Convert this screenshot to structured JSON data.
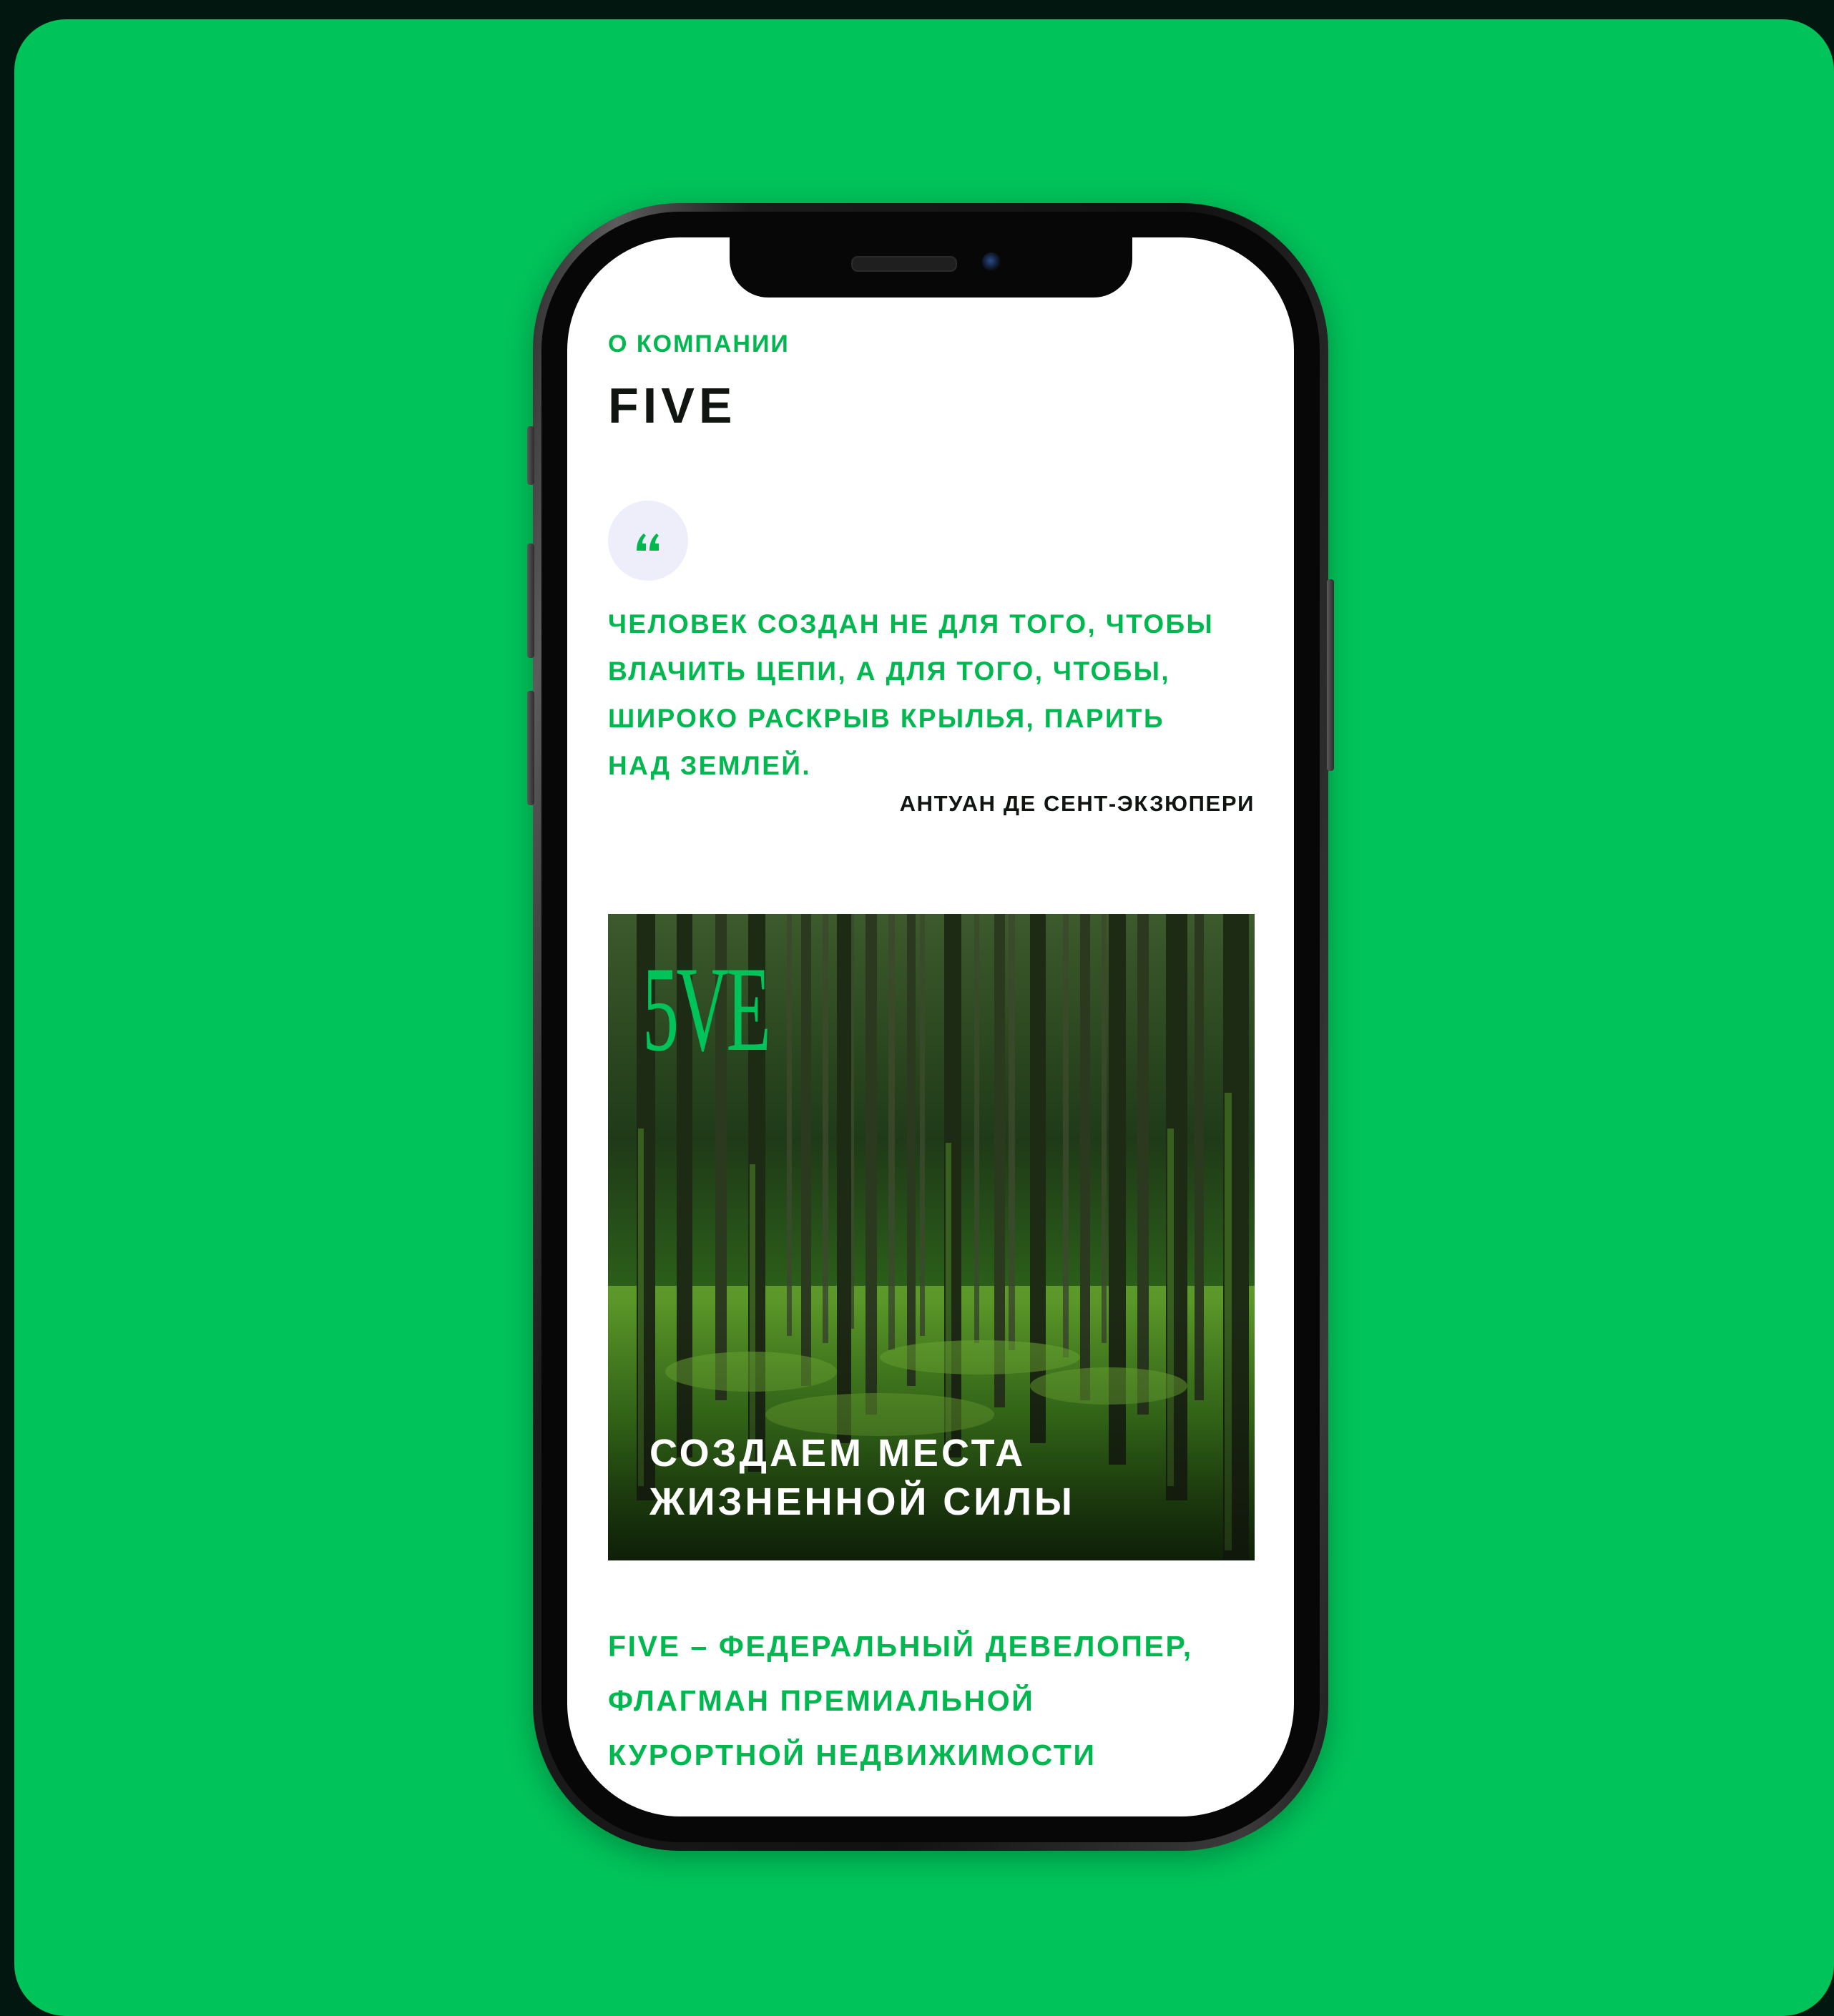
{
  "section_label": "О КОМПАНИИ",
  "company_name": "FIVE",
  "quote": {
    "icon": "quote-mark-icon",
    "text": "ЧЕЛОВЕК СОЗДАН НЕ ДЛЯ ТОГО, ЧТОБЫ\nВЛАЧИТЬ ЦЕПИ, А ДЛЯ ТОГО, ЧТОБЫ,\nШИРОКО РАСКРЫВ КРЫЛЬЯ, ПАРИТЬ\nНАД ЗЕМЛЕЙ.",
    "author": "АНТУАН ДЕ СЕНТ-ЭКЗЮПЕРИ"
  },
  "hero_image": {
    "logo_text": "5VE",
    "caption": "СОЗДАЕМ МЕСТА\nЖИЗНЕННОЙ СИЛЫ"
  },
  "about": "FIVE – ФЕДЕРАЛЬНЫЙ ДЕВЕЛОПЕР,\nФЛАГМАН ПРЕМИАЛЬНОЙ\nКУРОРТНОЙ НЕДВИЖИМОСТИ",
  "colors": {
    "background": "#00c35a",
    "accent": "#00b84f",
    "text_dark": "#111512",
    "badge_bg": "#eeeefa"
  }
}
